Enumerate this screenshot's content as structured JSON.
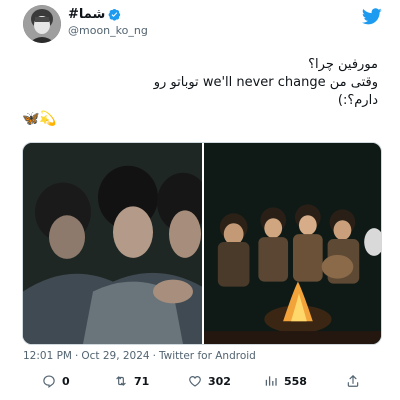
{
  "author": {
    "display_name": "شما#",
    "handle": "@moon_ko_ng",
    "avatar_icon": "profile-photo",
    "verified": true
  },
  "brand": {
    "logo": "twitter-bird-icon",
    "color": "#1d9bf0"
  },
  "tweet": {
    "lines": [
      "مورفین چرا؟",
      "وقتی من we'll never change توباتو رو",
      "دارم؟:)"
    ],
    "emojis": "🦋💫"
  },
  "media": {
    "count": 2,
    "items": [
      "group-photo-left",
      "campfire-photo-right"
    ]
  },
  "meta": {
    "time": "12:01 PM",
    "date": "Oct 29, 2024",
    "source": "Twitter for Android"
  },
  "actions": {
    "reply_count": "0",
    "retweet_count": "71",
    "like_count": "302",
    "view_count": "558"
  },
  "colors": {
    "text": "#0f1419",
    "secondary": "#536471",
    "accent": "#1d9bf0",
    "border": "#cfd9de"
  }
}
